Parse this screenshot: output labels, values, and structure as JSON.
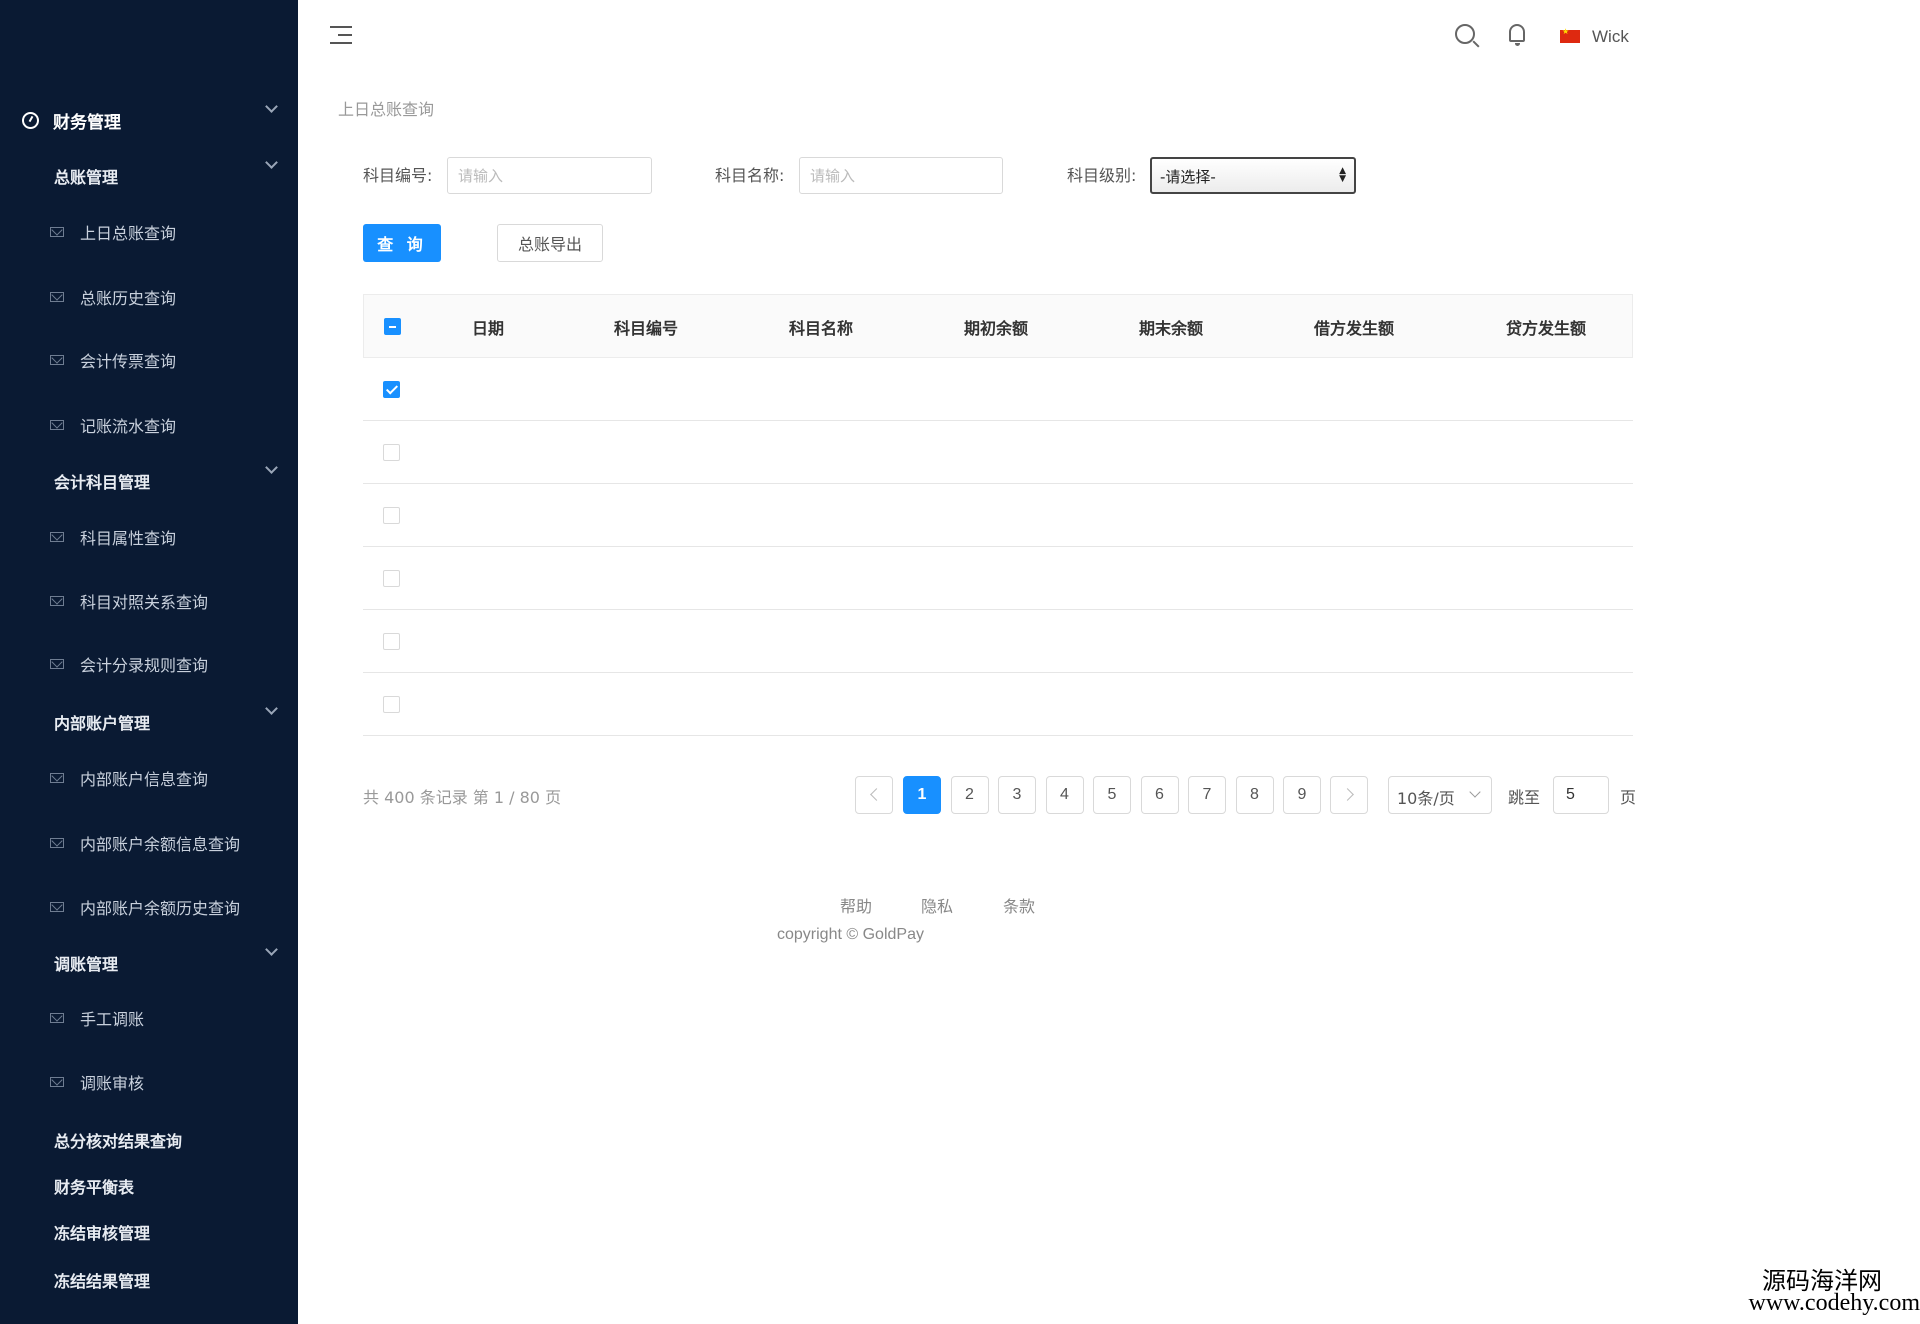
{
  "sidebar": {
    "items": [
      {
        "label": "财务管理",
        "level": 0,
        "icon": "gauge-icon",
        "expandable": true
      },
      {
        "label": "总账管理",
        "level": 1,
        "expandable": true
      },
      {
        "label": "上日总账查询",
        "level": 2,
        "icon": "mail-icon"
      },
      {
        "label": "总账历史查询",
        "level": 2,
        "icon": "mail-icon"
      },
      {
        "label": "会计传票查询",
        "level": 2,
        "icon": "mail-icon"
      },
      {
        "label": "记账流水查询",
        "level": 2,
        "icon": "mail-icon"
      },
      {
        "label": "会计科目管理",
        "level": 1,
        "expandable": true
      },
      {
        "label": "科目属性查询",
        "level": 2,
        "icon": "mail-icon"
      },
      {
        "label": "科目对照关系查询",
        "level": 2,
        "icon": "mail-icon"
      },
      {
        "label": "会计分录规则查询",
        "level": 2,
        "icon": "mail-icon"
      },
      {
        "label": "内部账户管理",
        "level": 1,
        "expandable": true
      },
      {
        "label": "内部账户信息查询",
        "level": 2,
        "icon": "mail-icon"
      },
      {
        "label": "内部账户余额信息查询",
        "level": 2,
        "icon": "mail-icon"
      },
      {
        "label": "内部账户余额历史查询",
        "level": 2,
        "icon": "mail-icon"
      },
      {
        "label": "调账管理",
        "level": 1,
        "expandable": true
      },
      {
        "label": "手工调账",
        "level": 2,
        "icon": "mail-icon"
      },
      {
        "label": "调账审核",
        "level": 2,
        "icon": "mail-icon"
      },
      {
        "label": "总分核对结果查询",
        "level": 1,
        "expandable": false
      },
      {
        "label": "财务平衡表",
        "level": 1,
        "expandable": false
      },
      {
        "label": "冻结审核管理",
        "level": 1,
        "expandable": false
      },
      {
        "label": "冻结结果管理",
        "level": 1,
        "expandable": false
      }
    ]
  },
  "header": {
    "username": "Wick",
    "icons": [
      "menu-toggle-icon",
      "search-icon",
      "bell-icon",
      "china-flag-icon"
    ]
  },
  "breadcrumb": "上日总账查询",
  "form": {
    "code_label": "科目编号:",
    "code_placeholder": "请输入",
    "name_label": "科目名称:",
    "name_placeholder": "请输入",
    "level_label": "科目级别:",
    "level_selected": "-请选择-",
    "query_button": "查 询",
    "export_button": "总账导出"
  },
  "table": {
    "columns": [
      "日期",
      "科目编号",
      "科目名称",
      "期初余额",
      "期末余额",
      "借方发生额",
      "贷方发生额"
    ],
    "header_checkbox": "indeterminate",
    "rows": [
      {
        "checked": true
      },
      {
        "checked": false
      },
      {
        "checked": false
      },
      {
        "checked": false
      },
      {
        "checked": false
      },
      {
        "checked": false
      }
    ]
  },
  "pagination": {
    "summary": "共 400 条记录 第 1 / 80 页",
    "pages": [
      "1",
      "2",
      "3",
      "4",
      "5",
      "6",
      "7",
      "8",
      "9"
    ],
    "current": "1",
    "page_size": "10条/页",
    "jump_label": "跳至",
    "jump_value": "5",
    "suffix": "页"
  },
  "footer": {
    "links": [
      "帮助",
      "隐私",
      "条款"
    ],
    "copyright": "copyright © GoldPay"
  },
  "watermark": {
    "line1": "源码海洋网",
    "line2": "www.codehy.com"
  },
  "colors": {
    "sidebar_bg": "#0a1a33",
    "accent": "#1890ff"
  }
}
